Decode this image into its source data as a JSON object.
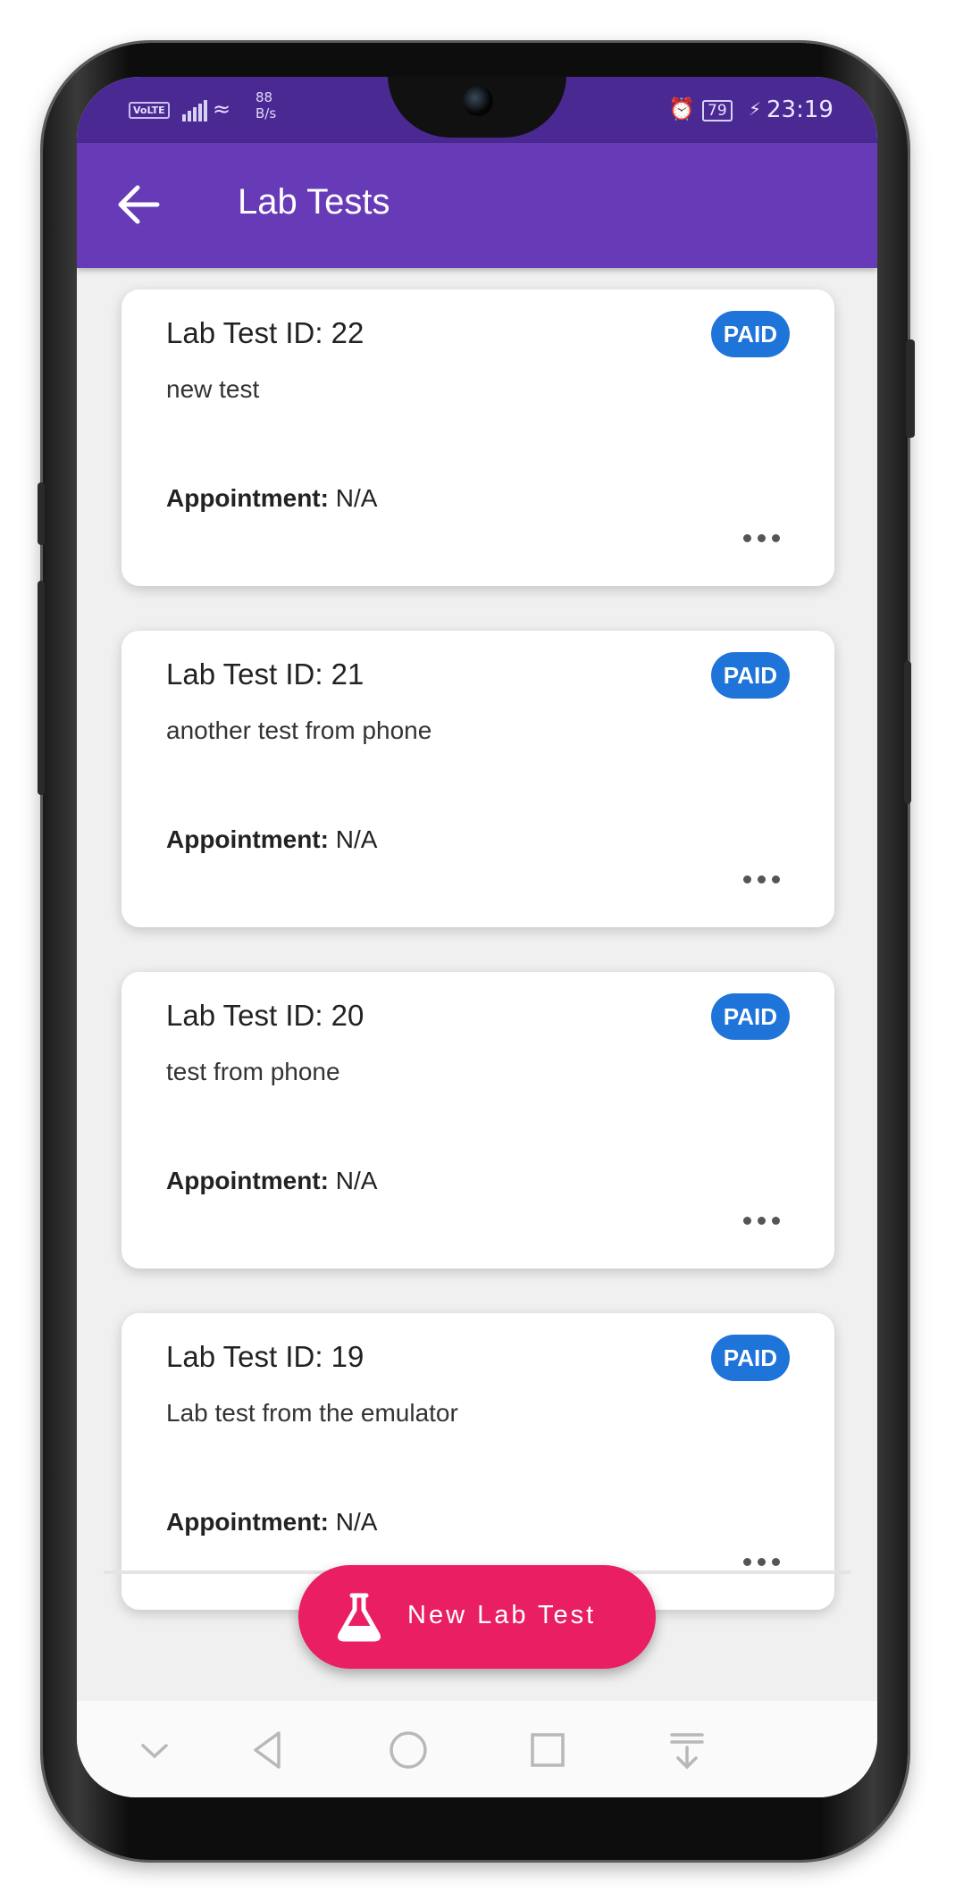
{
  "status_bar": {
    "network_badge": "VoLTE",
    "speed_value": "88",
    "speed_unit": "B/s",
    "battery": "79",
    "time": "23:19"
  },
  "app_bar": {
    "title": "Lab Tests",
    "back_icon": "arrow-back-icon"
  },
  "lab_tests": [
    {
      "id_label": "Lab Test ID: 22",
      "description": "new test",
      "status": "PAID",
      "appointment_label": "Appointment:",
      "appointment_value": "N/A"
    },
    {
      "id_label": "Lab Test ID: 21",
      "description": "another test from phone",
      "status": "PAID",
      "appointment_label": "Appointment:",
      "appointment_value": "N/A"
    },
    {
      "id_label": "Lab Test ID: 20",
      "description": "test from phone",
      "status": "PAID",
      "appointment_label": "Appointment:",
      "appointment_value": "N/A"
    },
    {
      "id_label": "Lab Test ID: 19",
      "description": "Lab test from the emulator",
      "status": "PAID",
      "appointment_label": "Appointment:",
      "appointment_value": "N/A"
    }
  ],
  "fab": {
    "label": "New Lab Test",
    "icon": "flask-icon"
  },
  "colors": {
    "status_bar": "#4a2a92",
    "app_bar": "#673ab7",
    "badge": "#1e74d9",
    "fab": "#e91e63"
  }
}
